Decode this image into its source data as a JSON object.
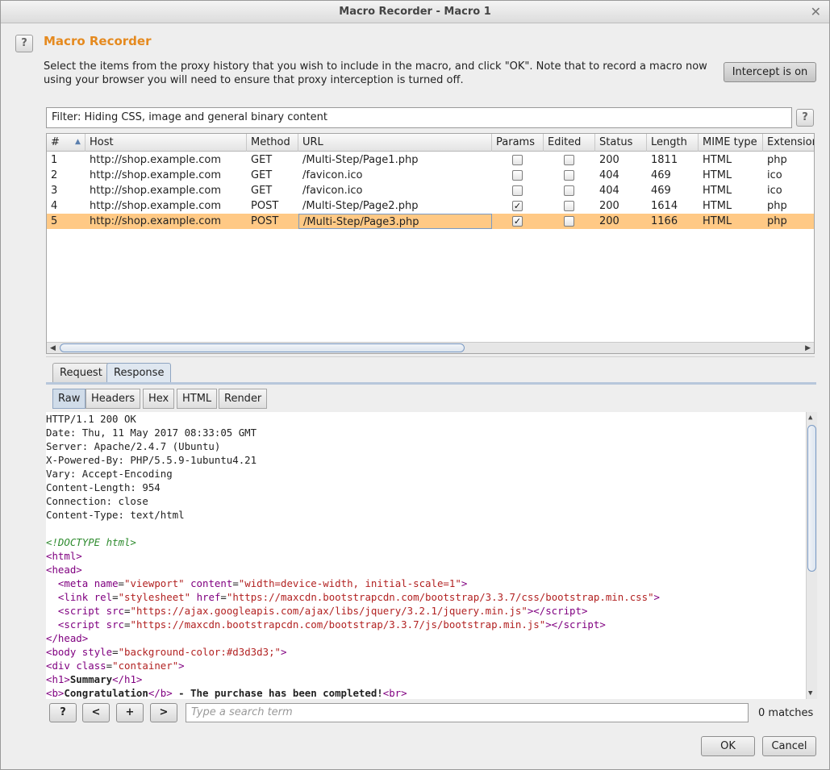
{
  "window": {
    "title": "Macro Recorder - Macro 1"
  },
  "header": {
    "heading": "Macro Recorder",
    "description": "Select the items from the proxy history that you wish to include in the macro, and click \"OK\". Note that to record a macro now using your browser you will need to ensure that proxy interception is turned off.",
    "intercept_label": "Intercept is on",
    "help_label": "?"
  },
  "filter": {
    "text": "Filter: Hiding CSS, image and general binary content",
    "help_label": "?"
  },
  "table": {
    "columns": [
      "#",
      "Host",
      "Method",
      "URL",
      "Params",
      "Edited",
      "Status",
      "Length",
      "MIME type",
      "Extension"
    ],
    "sort_icon": "sort-ascending-icon",
    "rows": [
      {
        "num": "1",
        "host": "http://shop.example.com",
        "method": "GET",
        "url": "/Multi-Step/Page1.php",
        "params": false,
        "edited": false,
        "status": "200",
        "length": "1811",
        "mime": "HTML",
        "ext": "php"
      },
      {
        "num": "2",
        "host": "http://shop.example.com",
        "method": "GET",
        "url": "/favicon.ico",
        "params": false,
        "edited": false,
        "status": "404",
        "length": "469",
        "mime": "HTML",
        "ext": "ico"
      },
      {
        "num": "3",
        "host": "http://shop.example.com",
        "method": "GET",
        "url": "/favicon.ico",
        "params": false,
        "edited": false,
        "status": "404",
        "length": "469",
        "mime": "HTML",
        "ext": "ico"
      },
      {
        "num": "4",
        "host": "http://shop.example.com",
        "method": "POST",
        "url": "/Multi-Step/Page2.php",
        "params": true,
        "edited": false,
        "status": "200",
        "length": "1614",
        "mime": "HTML",
        "ext": "php"
      },
      {
        "num": "5",
        "host": "http://shop.example.com",
        "method": "POST",
        "url": "/Multi-Step/Page3.php",
        "params": true,
        "edited": false,
        "status": "200",
        "length": "1166",
        "mime": "HTML",
        "ext": "php"
      }
    ],
    "selected_row": "5"
  },
  "tabs": {
    "request": "Request",
    "response": "Response",
    "active": "Response"
  },
  "subtabs": {
    "raw": "Raw",
    "headers": "Headers",
    "hex": "Hex",
    "html": "HTML",
    "render": "Render",
    "active": "Raw"
  },
  "response": {
    "headers": [
      "HTTP/1.1 200 OK",
      "Date: Thu, 11 May 2017 08:33:05 GMT",
      "Server: Apache/2.4.7 (Ubuntu)",
      "X-Powered-By: PHP/5.5.9-1ubuntu4.21",
      "Vary: Accept-Encoding",
      "Content-Length: 954",
      "Connection: close",
      "Content-Type: text/html"
    ],
    "doctype": "<!DOCTYPE html>",
    "viewport_value": "width=device-width, initial-scale=1",
    "bootstrap_css": "https://maxcdn.bootstrapcdn.com/bootstrap/3.3.7/css/bootstrap.min.css",
    "jquery_js": "https://ajax.googleapis.com/ajax/libs/jquery/3.2.1/jquery.min.js",
    "bootstrap_js": "https://maxcdn.bootstrapcdn.com/bootstrap/3.3.7/js/bootstrap.min.js",
    "body_style": "background-color:#d3d3d3;",
    "div_class": "container",
    "h1_text": "Summary",
    "b_text": "Congratulation",
    "after_b": " - The purchase has been completed!"
  },
  "search": {
    "help_label": "?",
    "prev_label": "<",
    "add_label": "+",
    "next_label": ">",
    "placeholder": "Type a search term",
    "matches": "0 matches"
  },
  "footer": {
    "ok_label": "OK",
    "cancel_label": "Cancel"
  },
  "colors": {
    "heading": "#e58a1f",
    "selected_row": "#ffc985",
    "tag": "#800080",
    "string": "#b22222",
    "doctype": "#2e8b2e"
  }
}
